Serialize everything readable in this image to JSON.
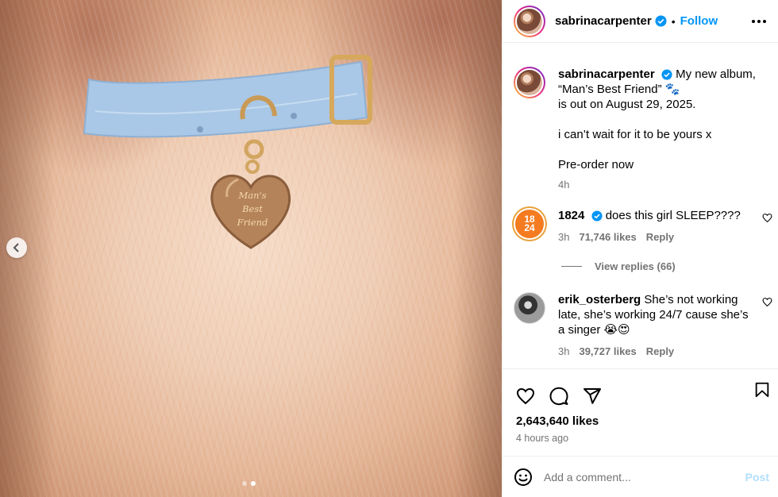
{
  "post": {
    "tag_lines": [
      "Man's",
      "Best",
      "Friend"
    ],
    "carousel": {
      "slide_index": 2,
      "slide_count": 2
    }
  },
  "header": {
    "username": "sabrinacarpenter",
    "separator": "•",
    "follow_label": "Follow"
  },
  "caption": {
    "username": "sabrinacarpenter",
    "line1": "My new album,",
    "line2": "“Man’s Best Friend” 🐾",
    "line3": "is out on August 29, 2025.",
    "line4": "i can’t wait for it to be yours x",
    "line5": "Pre-order now",
    "time": "4h"
  },
  "comments": [
    {
      "username": "1824",
      "text": "does this girl SLEEP????",
      "time": "3h",
      "likes": "71,746 likes",
      "reply_label": "Reply",
      "avatar_text": "18 24"
    },
    {
      "username": "erik_osterberg",
      "text": "She’s not working late, she’s working 24/7 cause she’s a singer 😭😍",
      "time": "3h",
      "likes": "39,727 likes",
      "reply_label": "Reply"
    }
  ],
  "view_replies": "View replies (66)",
  "stats": {
    "likes": "2,643,640 likes",
    "time_ago": "4 hours ago"
  },
  "composer": {
    "placeholder": "Add a comment...",
    "post_label": "Post"
  },
  "colors": {
    "accent": "#0095f6",
    "collar": "#a9c7e6",
    "tag_gold": "#b5835a",
    "orange_avatar": "#f47b20"
  },
  "icons": [
    "chevron-left-icon",
    "verified-icon",
    "more-icon",
    "heart-icon",
    "comment-icon",
    "share-icon",
    "bookmark-icon",
    "emoji-icon"
  ]
}
